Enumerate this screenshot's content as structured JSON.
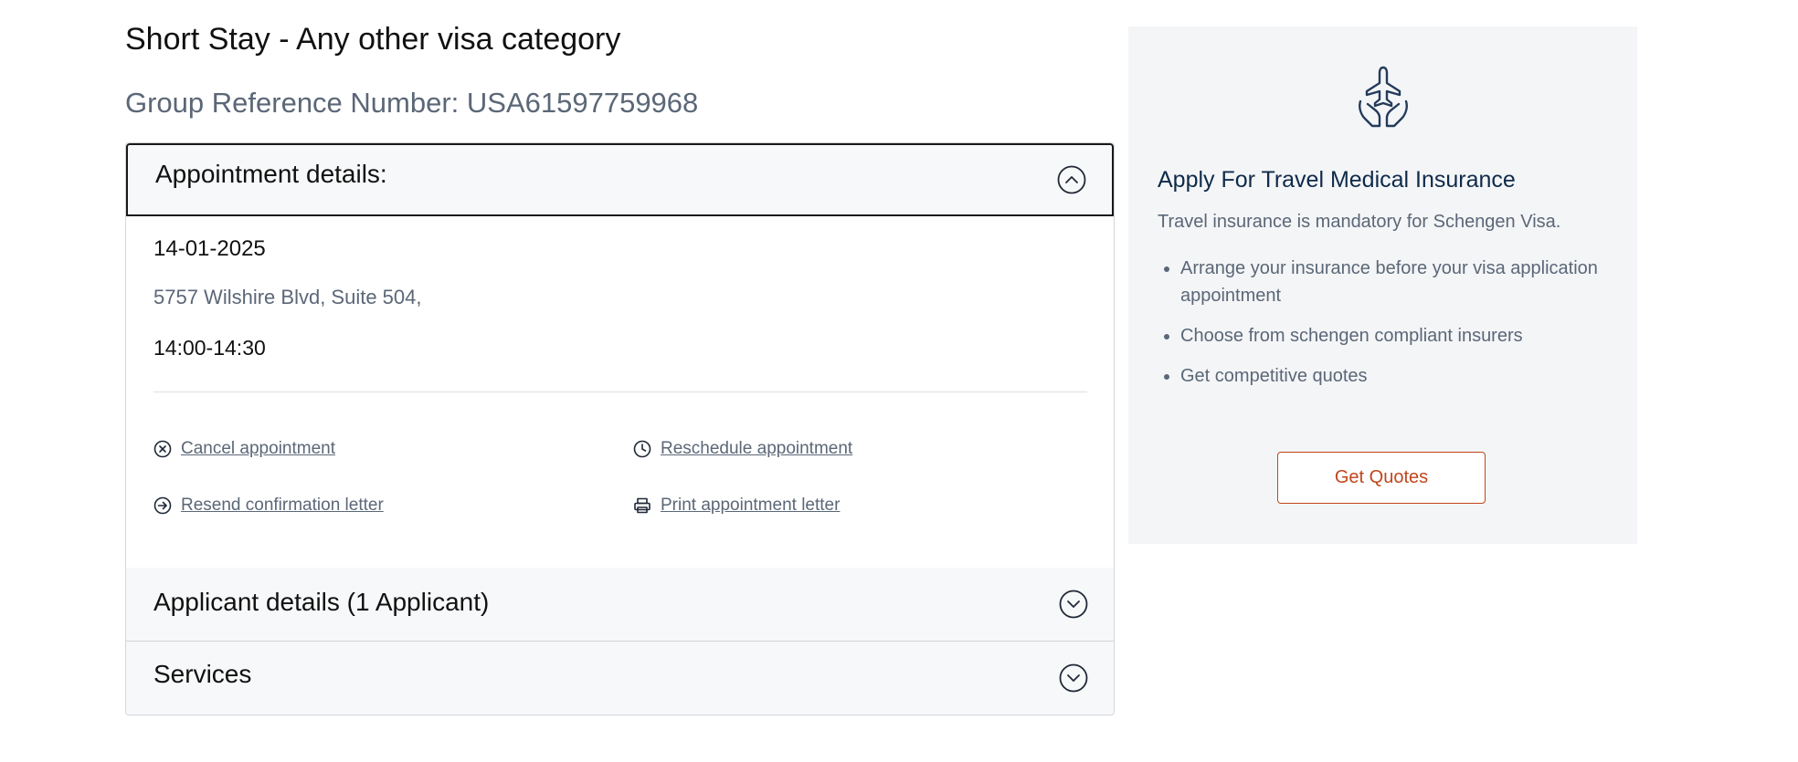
{
  "page": {
    "title": "Short Stay - Any other visa category",
    "group_reference": "Group Reference Number: USA61597759968"
  },
  "accordion": {
    "appointment": {
      "title": "Appointment details:",
      "expanded": true,
      "date": "14-01-2025",
      "address": "5757 Wilshire Blvd, Suite 504,",
      "time": "14:00-14:30",
      "actions": {
        "cancel": {
          "label": "Cancel appointment",
          "icon": "circle-x-icon"
        },
        "reschedule": {
          "label": "Reschedule appointment",
          "icon": "clock-icon"
        },
        "resend": {
          "label": "Resend confirmation letter",
          "icon": "circle-arrow-right-icon"
        },
        "print": {
          "label": "Print appointment letter",
          "icon": "printer-icon"
        }
      }
    },
    "applicants": {
      "title": "Applicant details (1 Applicant)",
      "expanded": false
    },
    "services": {
      "title": "Services",
      "expanded": false
    }
  },
  "promo": {
    "icon": "plane-in-hands-icon",
    "title": "Apply For Travel Medical Insurance",
    "text": "Travel insurance is mandatory for Schengen Visa.",
    "bullets": [
      "Arrange your insurance before your visa application appointment",
      "Choose from schengen compliant insurers",
      "Get competitive quotes"
    ],
    "button_label": "Get Quotes"
  },
  "colors": {
    "accent": "#c0461b",
    "muted_text": "#5b6777",
    "heading_blue": "#0f2a4a",
    "panel_bg": "#f4f5f7",
    "header_bg": "#f7f8f9"
  }
}
